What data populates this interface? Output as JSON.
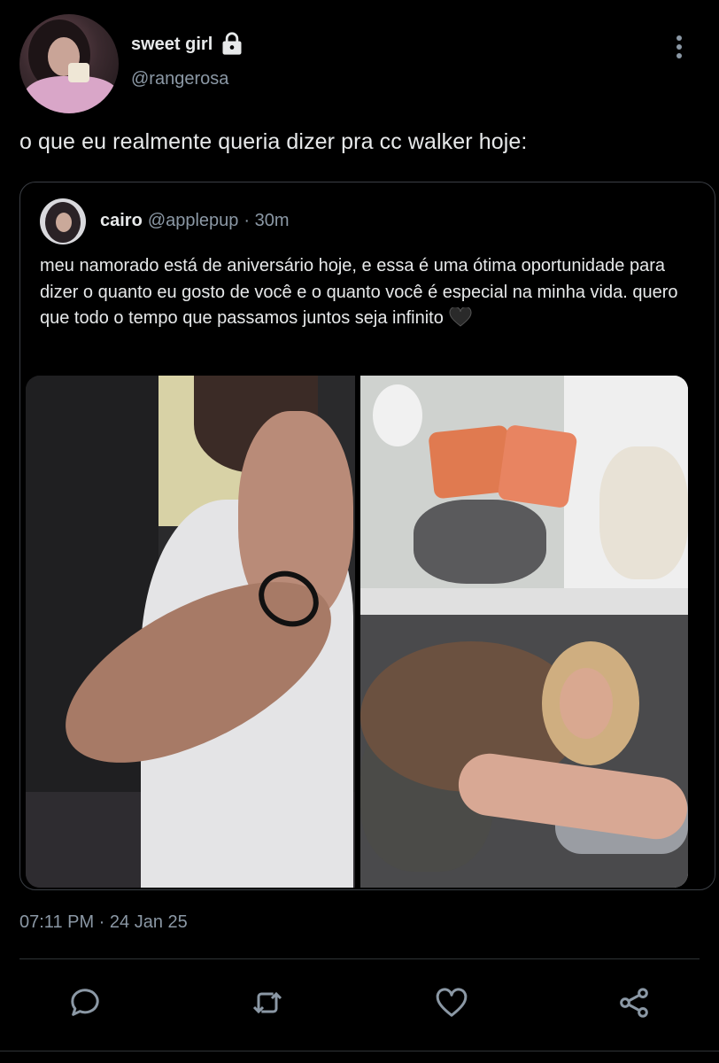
{
  "author": {
    "display_name": "sweet girl",
    "handle": "@rangerosa",
    "protected": true
  },
  "tweet": {
    "text": "o que eu realmente queria dizer pra cc walker hoje:",
    "timestamp": "07:11 PM · 24 Jan 25"
  },
  "quoted": {
    "display_name": "cairo",
    "handle": "@applepup",
    "time": "· 30m",
    "text": "meu namorado está de aniversário hoje, e essa é uma ótima oportunidade para dizer o quanto eu gosto de você e o quanto você é especial na minha vida. quero que todo o tempo que passamos juntos seja infinito",
    "emoji": "black-heart-icon",
    "media_count": 2
  },
  "actions": [
    "reply-icon",
    "retweet-icon",
    "like-icon",
    "share-icon"
  ],
  "colors": {
    "background": "#000000",
    "text": "#e7e9ea",
    "secondary": "#8b98a5",
    "border": "#3b3f45"
  }
}
